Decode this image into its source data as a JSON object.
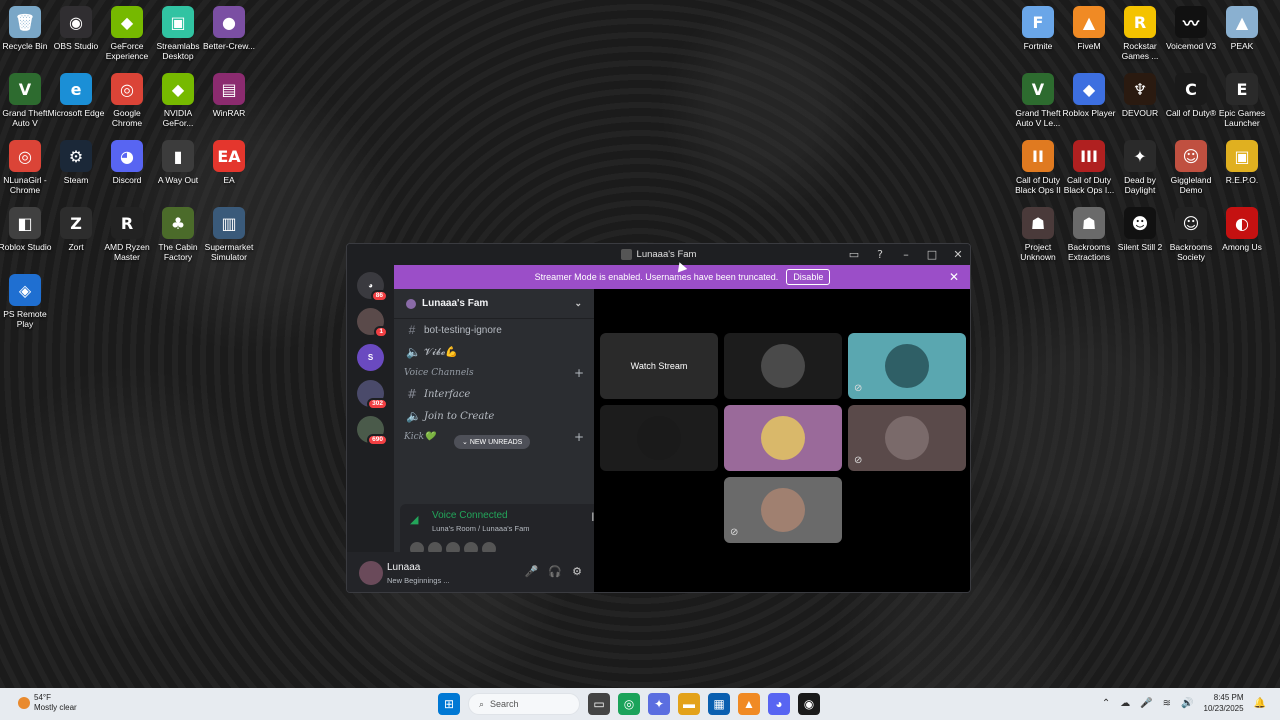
{
  "desktop": {
    "left_icons": [
      {
        "label": "Recycle Bin",
        "icon": "recycle-bin-icon",
        "color": "#7aa7c7",
        "glyph": "🗑"
      },
      {
        "label": "OBS Studio",
        "icon": "obs-icon",
        "color": "#302e31",
        "glyph": "◉"
      },
      {
        "label": "GeForce Experience",
        "icon": "geforce-icon",
        "color": "#76b900",
        "glyph": "◆"
      },
      {
        "label": "Streamlabs Desktop",
        "icon": "streamlabs-icon",
        "color": "#31c3a2",
        "glyph": "▣"
      },
      {
        "label": "Better-Crew...",
        "icon": "bettercrew-icon",
        "color": "#7b4fa3",
        "glyph": "●"
      },
      {
        "label": "Grand Theft Auto V",
        "icon": "gta-icon",
        "color": "#2d6b2f",
        "glyph": "V"
      },
      {
        "label": "Microsoft Edge",
        "icon": "edge-icon",
        "color": "#1b8fd6",
        "glyph": "e"
      },
      {
        "label": "Google Chrome",
        "icon": "chrome-icon",
        "color": "#db4437",
        "glyph": "◎"
      },
      {
        "label": "NVIDIA GeFor...",
        "icon": "nvidia-icon",
        "color": "#76b900",
        "glyph": "◆"
      },
      {
        "label": "WinRAR",
        "icon": "winrar-icon",
        "color": "#8b2b6f",
        "glyph": "▤"
      },
      {
        "label": "NLunaGirl - Chrome",
        "icon": "chrome-profile-icon",
        "color": "#db4437",
        "glyph": "◎"
      },
      {
        "label": "Steam",
        "icon": "steam-icon",
        "color": "#1b2838",
        "glyph": "⚙"
      },
      {
        "label": "Discord",
        "icon": "discord-icon",
        "color": "#5865f2",
        "glyph": "◕"
      },
      {
        "label": "A Way Out",
        "icon": "awayout-icon",
        "color": "#3c3c3c",
        "glyph": "▮"
      },
      {
        "label": "EA",
        "icon": "ea-icon",
        "color": "#e4362d",
        "glyph": "EA"
      },
      {
        "label": "Roblox Studio",
        "icon": "roblox-studio-icon",
        "color": "#404040",
        "glyph": "◧"
      },
      {
        "label": "Zort",
        "icon": "zort-icon",
        "color": "#2d2d2d",
        "glyph": "Z"
      },
      {
        "label": "AMD Ryzen Master",
        "icon": "ryzen-icon",
        "color": "#222",
        "glyph": "R"
      },
      {
        "label": "The Cabin Factory",
        "icon": "cabin-icon",
        "color": "#4b6b2a",
        "glyph": "♣"
      },
      {
        "label": "Supermarket Simulator",
        "icon": "supermarket-icon",
        "color": "#3a5a7a",
        "glyph": "▥"
      },
      {
        "label": "PS Remote Play",
        "icon": "ps-remote-icon",
        "color": "#1f6fd1",
        "glyph": "◈"
      }
    ],
    "right_icons": [
      {
        "label": "Fortnite",
        "icon": "fortnite-icon",
        "color": "#6aa6e8",
        "glyph": "F"
      },
      {
        "label": "FiveM",
        "icon": "fivem-icon",
        "color": "#f08a24",
        "glyph": "▲"
      },
      {
        "label": "Rockstar Games ...",
        "icon": "rockstar-icon",
        "color": "#f4c300",
        "glyph": "R"
      },
      {
        "label": "Voicemod V3",
        "icon": "voicemod-icon",
        "color": "#111",
        "glyph": "〰"
      },
      {
        "label": "PEAK",
        "icon": "peak-icon",
        "color": "#8ab0d0",
        "glyph": "▲"
      },
      {
        "label": "Grand Theft Auto V Le...",
        "icon": "gta-legacy-icon",
        "color": "#2d6b2f",
        "glyph": "V"
      },
      {
        "label": "Roblox Player",
        "icon": "roblox-icon",
        "color": "#3d6fe0",
        "glyph": "◆"
      },
      {
        "label": "DEVOUR",
        "icon": "devour-icon",
        "color": "#2a1a10",
        "glyph": "♆"
      },
      {
        "label": "Call of Duty®",
        "icon": "cod-icon",
        "color": "#1a1a1a",
        "glyph": "C"
      },
      {
        "label": "Epic Games Launcher",
        "icon": "epic-icon",
        "color": "#2a2a2a",
        "glyph": "E"
      },
      {
        "label": "Call of Duty Black Ops II",
        "icon": "bo2-icon",
        "color": "#e07a20",
        "glyph": "II"
      },
      {
        "label": "Call of Duty Black Ops I...",
        "icon": "bo3-icon",
        "color": "#b02020",
        "glyph": "III"
      },
      {
        "label": "Dead by Daylight",
        "icon": "dbd-icon",
        "color": "#2a2a2a",
        "glyph": "✦"
      },
      {
        "label": "Giggleland Demo",
        "icon": "giggleland-icon",
        "color": "#c05040",
        "glyph": "☺"
      },
      {
        "label": "R.E.P.O.",
        "icon": "repo-icon",
        "color": "#e0b020",
        "glyph": "▣"
      },
      {
        "label": "Project Unknown",
        "icon": "project-unknown-icon",
        "color": "#4a3a3a",
        "glyph": "☗"
      },
      {
        "label": "Backrooms Extractions",
        "icon": "backrooms-ext-icon",
        "color": "#6a6a6a",
        "glyph": "☗"
      },
      {
        "label": "Silent Still 2",
        "icon": "silent-still-icon",
        "color": "#111",
        "glyph": "☻"
      },
      {
        "label": "Backrooms Society",
        "icon": "backrooms-soc-icon",
        "color": "#222",
        "glyph": "☺"
      },
      {
        "label": "Among Us",
        "icon": "amongus-icon",
        "color": "#c51111",
        "glyph": "◐"
      }
    ]
  },
  "discord": {
    "window_title": "Lunaaa's Fam",
    "banner": {
      "text": "Streamer Mode is enabled. Usernames have been truncated.",
      "button": "Disable",
      "color": "#9b4ec8"
    },
    "servers": [
      {
        "name": "discord-home",
        "badge": "86",
        "color": "#3a3a3f"
      },
      {
        "name": "server-1",
        "badge": "1",
        "color": "#5a4a4a"
      },
      {
        "name": "server-strip",
        "badge": "",
        "color": "#6a4ac0"
      },
      {
        "name": "server-folder",
        "badge": "302",
        "color": "#4a4a6a"
      },
      {
        "name": "server-folder-2",
        "badge": "690",
        "color": "#4a5a4a"
      }
    ],
    "guild_name": "Lunaaa's Fam",
    "channels": {
      "text1": "bot-testing-ignore",
      "voice1": "𝓥𝓲𝓫𝓮💪",
      "category_voice": "Voice Channels",
      "interface": "Interface",
      "join_to_create": "Join to Create",
      "kick": "Kick💚"
    },
    "new_unreads": "NEW UNREADS",
    "voice": {
      "status": "Voice Connected",
      "location": "Luna's Room / Lunaaa's Fam"
    },
    "user": {
      "name": "Lunaaa",
      "status": "New Beginnings ..."
    },
    "stage": {
      "watch_stream": "Watch Stream"
    }
  },
  "taskbar": {
    "weather_temp": "54°F",
    "weather_desc": "Mostly clear",
    "search_placeholder": "Search",
    "time": "8:45 PM",
    "date": "10/23/2025"
  }
}
